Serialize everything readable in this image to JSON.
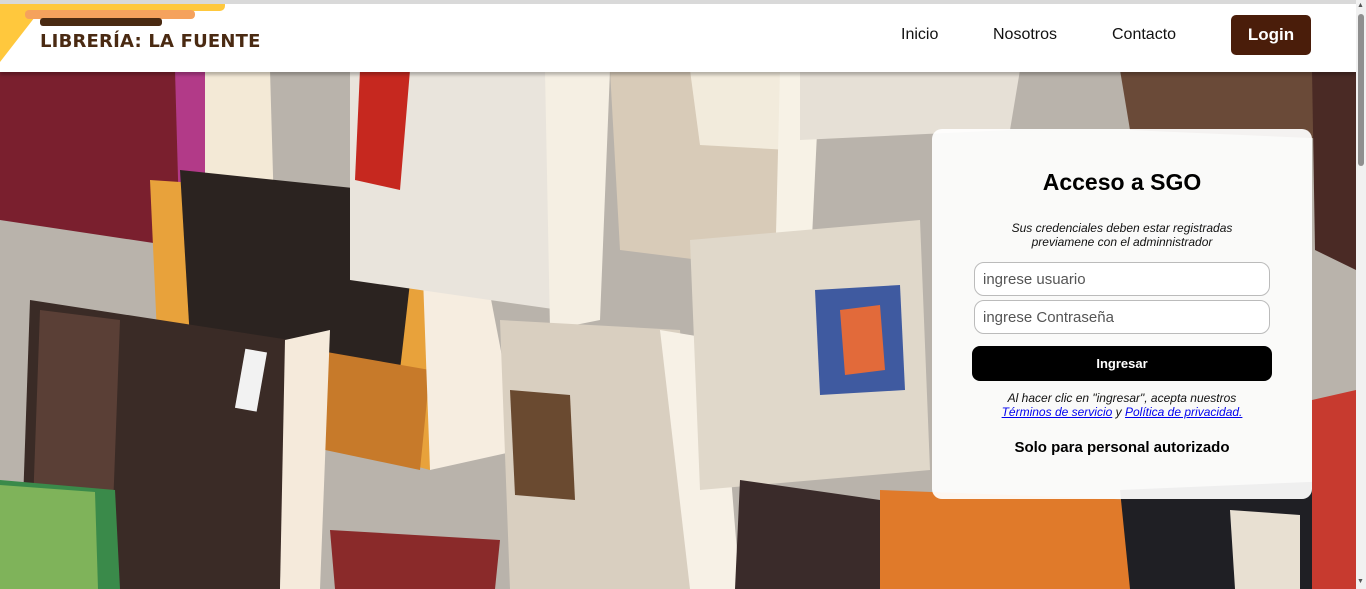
{
  "header": {
    "brand": "LIBRERÍA: LA FUENTE",
    "nav": [
      "Inicio",
      "Nosotros",
      "Contacto"
    ],
    "login_label": "Login"
  },
  "login_card": {
    "title": "Acceso a SGO",
    "note": "Sus credenciales deben estar registradas previamene con el adminnistrador",
    "username_placeholder": "ingrese usuario",
    "password_placeholder": "ingrese Contraseña",
    "submit_label": "Ingresar",
    "terms_prefix": "Al hacer clic en \"ingresar\", acepta nuestros",
    "terms_link": "Términos de servicio",
    "terms_and": "y",
    "privacy_link": "Política de privacidad.",
    "authorized_note": "Solo para personal autorizado"
  },
  "background": {
    "description_icon": "books-photo"
  },
  "colors": {
    "brand_text": "#4a2a12",
    "login_button": "#4a1d0a",
    "logo_yellow": "#ffc83d",
    "logo_orange": "#f5a25d"
  }
}
